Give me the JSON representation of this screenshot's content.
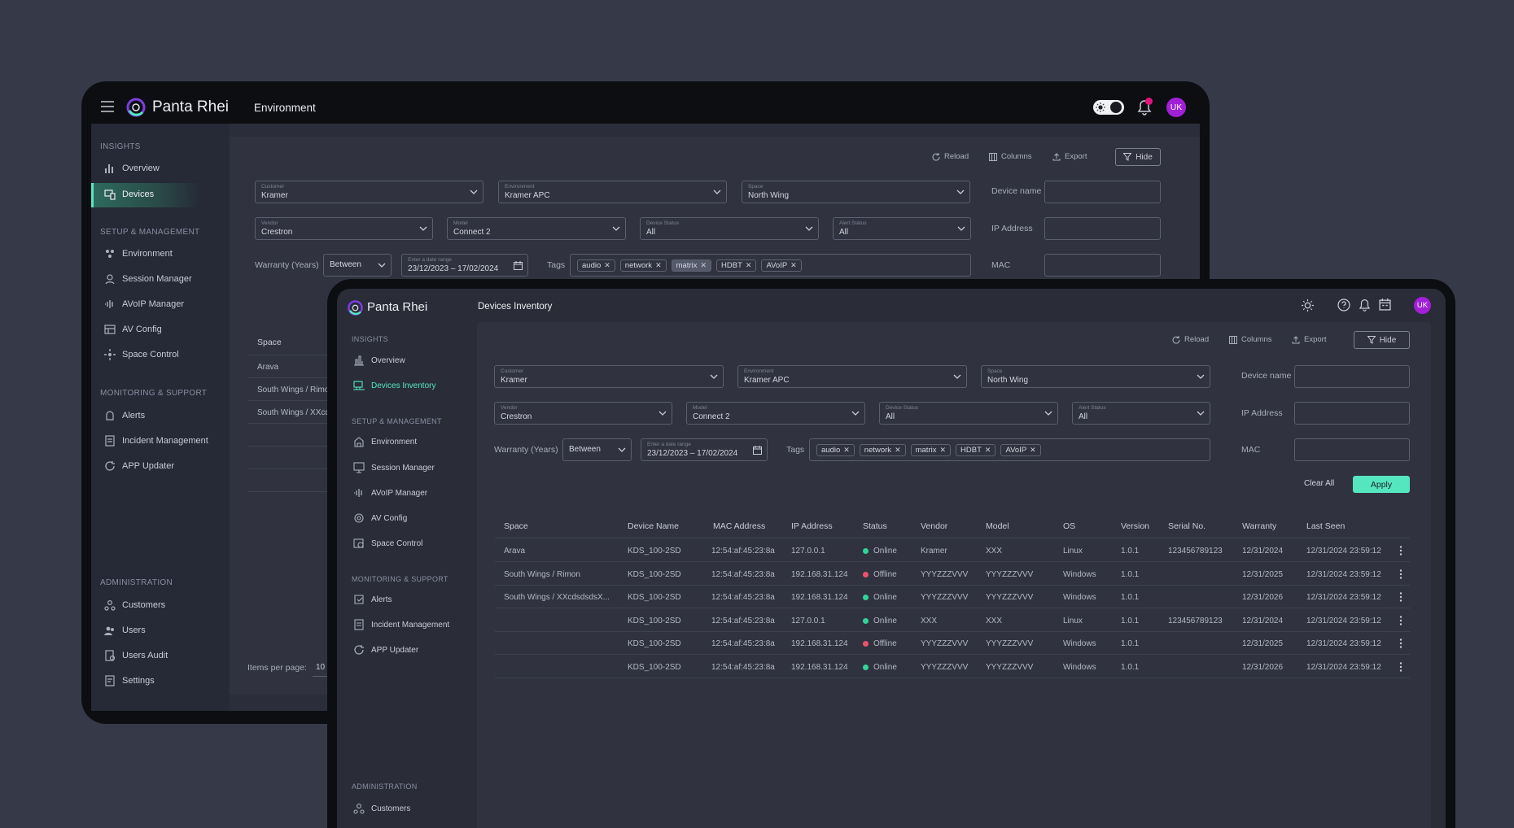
{
  "brand": {
    "name": "Panta Rhei",
    "avatar_initials": "UK",
    "accent": "#55e6c0",
    "avatar_color": "#a21fd8",
    "alert_dot": "#e3137b",
    "online": "#2fd59a",
    "offline": "#f0506e"
  },
  "back": {
    "page_title": "Environment",
    "sidebar": {
      "insights_label": "INSIGHTS",
      "insights": [
        "Overview",
        "Devices"
      ],
      "setup_label": "SETUP & MANAGEMENT",
      "setup": [
        "Environment",
        "Session Manager",
        "AVoIP Manager",
        "AV Config",
        "Space Control"
      ],
      "monitoring_label": "MONITORING & SUPPORT",
      "monitoring": [
        "Alerts",
        "Incident Management",
        "APP Updater"
      ],
      "admin_label": "ADMINISTRATION",
      "admin": [
        "Customers",
        "Users",
        "Users Audit",
        "Settings"
      ]
    },
    "toolbar": {
      "reload": "Reload",
      "columns": "Columns",
      "export": "Export",
      "hide": "Hide"
    },
    "filters": {
      "customer_label": "Customer",
      "customer": "Kramer",
      "environment_label": "Environment",
      "environment": "Kramer APC",
      "space_label": "Space",
      "space": "North Wing",
      "vendor_label": "Vendor",
      "vendor": "Crestron",
      "model_label": "Model",
      "model": "Connect 2",
      "device_status_label": "Device Status",
      "device_status": "All",
      "alert_status_label": "Alert Status",
      "alert_status": "All",
      "warranty_label": "Warranty (Years)",
      "warranty_op": "Between",
      "date_label": "Enter a date range",
      "date_range": "23/12/2023 – 17/02/2024",
      "tags_label": "Tags",
      "tags": [
        "audio",
        "network",
        "matrix",
        "HDBT",
        "AVoIP"
      ],
      "device_name_label": "Device name",
      "ip_label": "IP Address",
      "mac_label": "MAC"
    },
    "table": {
      "space_header": "Space",
      "rows": [
        "Arava",
        "South Wings / Rimon",
        "South Wings / XXcdsdsdsX"
      ]
    },
    "pagination": {
      "items_per_page_label": "Items per page:",
      "items_per_page": "10"
    }
  },
  "front": {
    "page_title": "Devices Inventory",
    "sidebar": {
      "insights_label": "INSIGHTS",
      "insights": [
        "Overview",
        "Devices Inventory"
      ],
      "setup_label": "SETUP & MANAGEMENT",
      "setup": [
        "Environment",
        "Session Manager",
        "AVoIP Manager",
        "AV Config",
        "Space Control"
      ],
      "monitoring_label": "MONITORING & SUPPORT",
      "monitoring": [
        "Alerts",
        "Incident Management",
        "APP Updater"
      ],
      "admin_label": "ADMINISTRATION",
      "admin": [
        "Customers"
      ]
    },
    "toolbar": {
      "reload": "Reload",
      "columns": "Columns",
      "export": "Export",
      "hide": "Hide"
    },
    "actions": {
      "clear_all": "Clear All",
      "apply": "Apply"
    },
    "table": {
      "headers": [
        "Space",
        "Device Name",
        "MAC Address",
        "IP Address",
        "Status",
        "Vendor",
        "Model",
        "OS",
        "Version",
        "Serial No.",
        "Warranty",
        "Last Seen"
      ],
      "rows": [
        {
          "space": "Arava",
          "device": "KDS_100-2SD",
          "mac": "12:54:af:45:23:8a",
          "ip": "127.0.0.1",
          "status": "Online",
          "vendor": "Kramer",
          "model": "XXX",
          "os": "Linux",
          "version": "1.0.1",
          "serial": "123456789123",
          "warranty": "12/31/2024",
          "last_seen": "12/31/2024 23:59:12"
        },
        {
          "space": "South Wings / Rimon",
          "device": "KDS_100-2SD",
          "mac": "12:54:af:45:23:8a",
          "ip": "192.168.31.124",
          "status": "Offline",
          "vendor": "YYYZZZVVV",
          "model": "YYYZZZVVV",
          "os": "Windows",
          "version": "1.0.1",
          "serial": "",
          "warranty": "12/31/2025",
          "last_seen": "12/31/2024 23:59:12"
        },
        {
          "space": "South Wings / XXcdsdsdsX...",
          "device": "KDS_100-2SD",
          "mac": "12:54:af:45:23:8a",
          "ip": "192.168.31.124",
          "status": "Online",
          "vendor": "YYYZZZVVV",
          "model": "YYYZZZVVV",
          "os": "Windows",
          "version": "1.0.1",
          "serial": "",
          "warranty": "12/31/2026",
          "last_seen": "12/31/2024 23:59:12"
        },
        {
          "space": "",
          "device": "KDS_100-2SD",
          "mac": "12:54:af:45:23:8a",
          "ip": "127.0.0.1",
          "status": "Online",
          "vendor": "XXX",
          "model": "XXX",
          "os": "Linux",
          "version": "1.0.1",
          "serial": "123456789123",
          "warranty": "12/31/2024",
          "last_seen": "12/31/2024 23:59:12"
        },
        {
          "space": "",
          "device": "KDS_100-2SD",
          "mac": "12:54:af:45:23:8a",
          "ip": "192.168.31.124",
          "status": "Offline",
          "vendor": "YYYZZZVVV",
          "model": "YYYZZZVVV",
          "os": "Windows",
          "version": "1.0.1",
          "serial": "",
          "warranty": "12/31/2025",
          "last_seen": "12/31/2024 23:59:12"
        },
        {
          "space": "",
          "device": "KDS_100-2SD",
          "mac": "12:54:af:45:23:8a",
          "ip": "192.168.31.124",
          "status": "Online",
          "vendor": "YYYZZZVVV",
          "model": "YYYZZZVVV",
          "os": "Windows",
          "version": "1.0.1",
          "serial": "",
          "warranty": "12/31/2026",
          "last_seen": "12/31/2024 23:59:12"
        }
      ]
    }
  }
}
